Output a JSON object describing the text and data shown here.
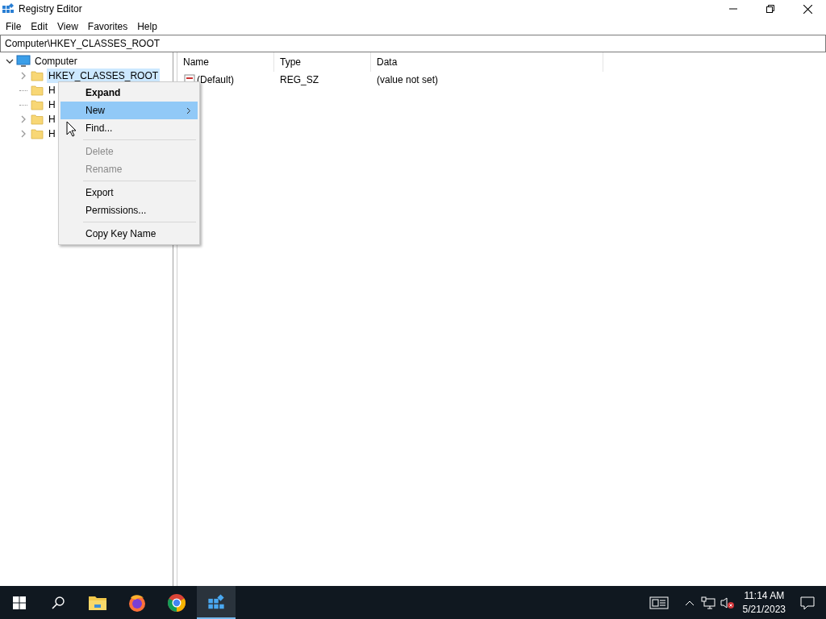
{
  "window": {
    "title": "Registry Editor"
  },
  "menu_bar": [
    "File",
    "Edit",
    "View",
    "Favorites",
    "Help"
  ],
  "address": "Computer\\HKEY_CLASSES_ROOT",
  "tree": {
    "label": "Computer",
    "expanded": true,
    "children": [
      {
        "label": "HKEY_CLASSES_ROOT",
        "expandable": true,
        "selected": true
      },
      {
        "label": "H",
        "expandable": false,
        "selected": false
      },
      {
        "label": "H",
        "expandable": false,
        "selected": false
      },
      {
        "label": "H",
        "expandable": true,
        "selected": false
      },
      {
        "label": "H",
        "expandable": true,
        "selected": false
      }
    ]
  },
  "table": {
    "columns": [
      "Name",
      "Type",
      "Data"
    ],
    "rows": [
      {
        "name": "(Default)",
        "type": "REG_SZ",
        "data": "(value not set)"
      }
    ]
  },
  "context_menu": [
    {
      "kind": "item",
      "label": "Expand",
      "bold": true,
      "selected": false,
      "disabled": false
    },
    {
      "kind": "submenu",
      "label": "New",
      "bold": false,
      "selected": true,
      "disabled": false
    },
    {
      "kind": "item",
      "label": "Find...",
      "bold": false,
      "selected": false,
      "disabled": false
    },
    {
      "kind": "separator"
    },
    {
      "kind": "item",
      "label": "Delete",
      "bold": false,
      "selected": false,
      "disabled": true
    },
    {
      "kind": "item",
      "label": "Rename",
      "bold": false,
      "selected": false,
      "disabled": true
    },
    {
      "kind": "separator"
    },
    {
      "kind": "item",
      "label": "Export",
      "bold": false,
      "selected": false,
      "disabled": false
    },
    {
      "kind": "item",
      "label": "Permissions...",
      "bold": false,
      "selected": false,
      "disabled": false
    },
    {
      "kind": "separator"
    },
    {
      "kind": "item",
      "label": "Copy Key Name",
      "bold": false,
      "selected": false,
      "disabled": false
    }
  ],
  "taskbar": {
    "time": "11:14 AM",
    "date": "5/21/2023"
  }
}
